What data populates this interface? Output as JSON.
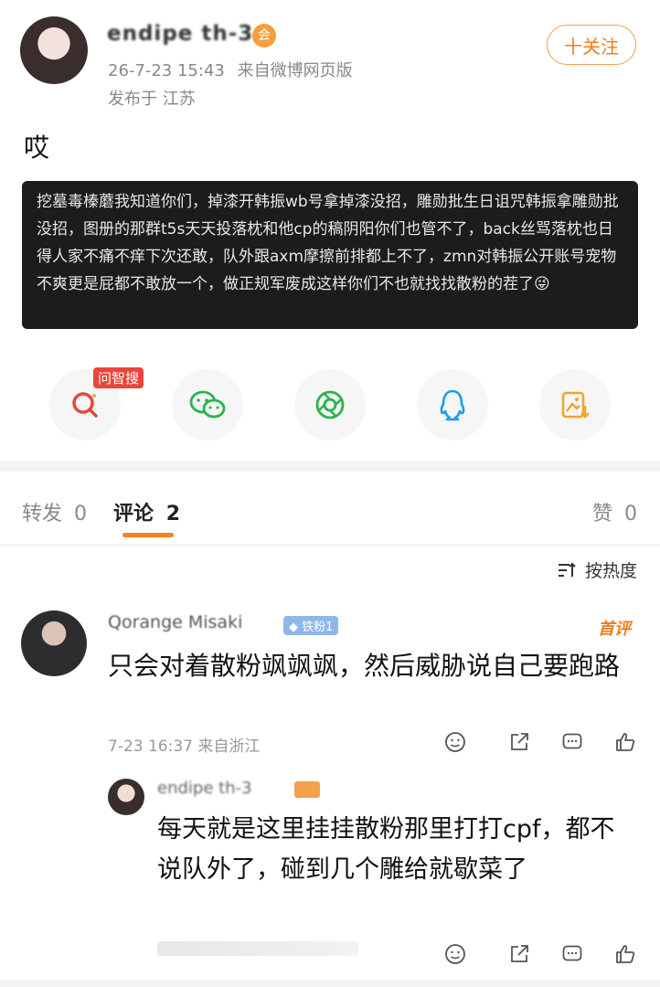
{
  "post": {
    "username": "endipe th‑3",
    "vip_badge": "会",
    "timestamp": "26-7-23 15:43",
    "source": "来自微博网页版",
    "location": "发布于 江苏",
    "follow_label": "十关注",
    "title": "哎",
    "quote_text": "挖墓毒榛蘑我知道你们，掉漆开韩振wb号拿掉漆没招，雕勋批生日诅咒韩振拿雕勋批没招，图册的那群t5s天天投落枕和他cp的稿阴阳你们也管不了，back丝骂落枕也日得人家不痛不痒下次还敢，队外跟axm摩擦前排都上不了，zmn对韩振公开账号宠物不爽更是屁都不敢放一个，做正规军废成这样你们不也就找找散粉的茬了😜",
    "share_badge": "问智搜"
  },
  "tabs": {
    "repost_label": "转发",
    "repost_count": "0",
    "comment_label": "评论",
    "comment_count": "2",
    "like_label": "赞",
    "like_count": "0"
  },
  "sort_label": "按热度",
  "comments": [
    {
      "name": "Qorange Misaki",
      "fan_badge": "铁粉1",
      "hot_tag": "首评",
      "text": "只会对着散粉飒飒飒，然后威胁说自己要跑路",
      "meta": "7-23 16:37 来自浙江"
    }
  ],
  "reply": {
    "name": "endipe th‑3",
    "text": "每天就是这里挂挂散粉那里打打cpf，都不说队外了，碰到几个雕给就歇菜了"
  },
  "colors": {
    "accent": "#f5821f",
    "quote_bg": "#1c1c1c",
    "fan_badge": "#8fb8ea",
    "red_badge": "#e8463b"
  }
}
